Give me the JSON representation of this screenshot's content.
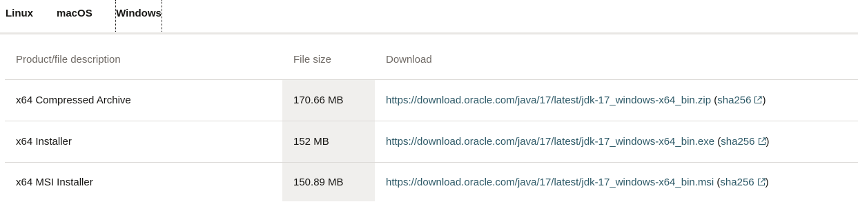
{
  "tabs": [
    {
      "label": "Linux",
      "active": false
    },
    {
      "label": "macOS",
      "active": false
    },
    {
      "label": "Windows",
      "active": true
    }
  ],
  "table": {
    "headers": [
      "Product/file description",
      "File size",
      "Download"
    ],
    "rows": [
      {
        "description": "x64 Compressed Archive",
        "size": "170.66 MB",
        "url": "https://download.oracle.com/java/17/latest/jdk-17_windows-x64_bin.zip",
        "checksum_label": "sha256"
      },
      {
        "description": "x64 Installer",
        "size": "152 MB",
        "url": "https://download.oracle.com/java/17/latest/jdk-17_windows-x64_bin.exe",
        "checksum_label": "sha256"
      },
      {
        "description": "x64 MSI Installer",
        "size": "150.89 MB",
        "url": "https://download.oracle.com/java/17/latest/jdk-17_windows-x64_bin.msi",
        "checksum_label": "sha256"
      }
    ]
  },
  "icons": {
    "external_link": "external-link-icon"
  },
  "colors": {
    "link": "#2d5967",
    "active_tab_underline": "#3f6b2a",
    "size_column_bg": "#f0efed",
    "header_text": "#6f6a65"
  }
}
